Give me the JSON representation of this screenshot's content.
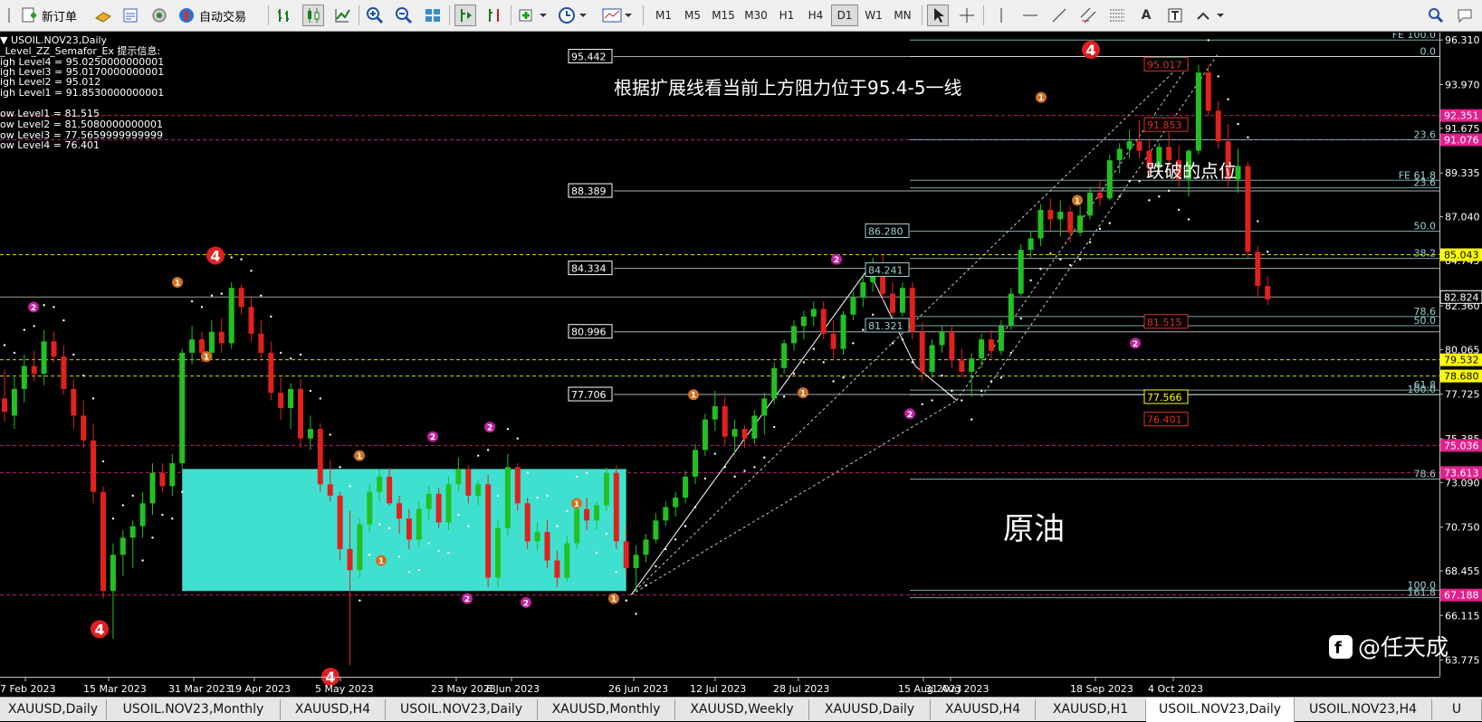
{
  "toolbar": {
    "new_order_label": "新订单",
    "autotrade_label": "自动交易",
    "timeframes": [
      "M1",
      "M5",
      "M15",
      "M30",
      "H1",
      "H4",
      "D1",
      "W1",
      "MN"
    ],
    "active_timeframe": "D1",
    "text_tool_label": "A"
  },
  "colors": {
    "background": "#000000",
    "bull": "#22c022",
    "bear": "#e0211e",
    "box": "#40e0d0",
    "fib": "#96d2d2",
    "res_line": "#e8e8e8"
  },
  "indicator_info": {
    "lines": [
      "▼ USOIL.NOV23,Daily",
      "_Level_ZZ_Semafor_Ex 提示信息:",
      "igh Level4 = 95.0250000000001",
      "igh Level3 = 95.0170000000001",
      "igh Level2 = 95.012",
      "igh Level1 = 91.8530000000001",
      "",
      "ow Level1 = 81.515",
      "ow Level2 = 81.5080000000001",
      "ow Level3 = 77.5659999999999",
      "ow Level4 = 76.401"
    ]
  },
  "annotations": {
    "resistance": "根据扩展线看当前上方阻力位于95.4-5一线",
    "breakdown": "跌破的点位",
    "instrument_cn": "原油"
  },
  "watermark": "@任天成",
  "chart_data": {
    "type": "candlestick",
    "symbol": "USOIL.NOV23",
    "timeframe": "Daily",
    "ylim": [
      62.9,
      96.7
    ],
    "price_axis": [
      "96.310",
      "93.970",
      "91.675",
      "89.335",
      "87.040",
      "84.745",
      "82.824",
      "82.360",
      "80.065",
      "77.725",
      "75.385",
      "73.090",
      "70.750",
      "68.455",
      "66.115",
      "63.775"
    ],
    "highlighted_prices": [
      {
        "value": "92.351",
        "color": "#e0208c"
      },
      {
        "value": "91.076",
        "color": "#e0208c"
      },
      {
        "value": "85.043",
        "color": "#ffff00"
      },
      {
        "value": "79.532",
        "color": "#ffff00"
      },
      {
        "value": "78.680",
        "color": "#ffff00"
      },
      {
        "value": "75.036",
        "color": "#e0208c"
      },
      {
        "value": "73.613",
        "color": "#e0208c"
      },
      {
        "value": "67.188",
        "color": "#e0208c"
      }
    ],
    "date_axis": [
      "7 Feb 2023",
      "15 Mar 2023",
      "31 Mar 2023",
      "19 Apr 2023",
      "5 May 2023",
      "23 May 2023",
      "8 Jun 2023",
      "26 Jun 2023",
      "12 Jul 2023",
      "28 Jul 2023",
      "15 Aug 2023",
      "31 Aug 2023",
      "18 Sep 2023",
      "4 Oct 2023"
    ],
    "left_labels": [
      {
        "text": "95.442",
        "y": 95.44
      },
      {
        "text": "88.389",
        "y": 88.39
      },
      {
        "text": "84.334",
        "y": 84.33
      },
      {
        "text": "80.996",
        "y": 81.0
      },
      {
        "text": "77.706",
        "y": 77.71
      }
    ],
    "mid_labels": [
      {
        "text": "86.280",
        "y": 86.28
      },
      {
        "text": "84.241",
        "y": 84.24
      },
      {
        "text": "81.321",
        "y": 81.32
      }
    ],
    "right_labels": [
      {
        "text": "95.017",
        "y": 95.02
      },
      {
        "text": "91.853",
        "y": 91.85
      },
      {
        "text": "81.515",
        "y": 81.52
      },
      {
        "text": "77.566",
        "y": 77.57
      },
      {
        "text": "76.401",
        "y": 76.4
      }
    ],
    "fib_levels": [
      {
        "text": "FE 100.0",
        "y": 96.31
      },
      {
        "text": "0.0",
        "y": 95.44
      },
      {
        "text": "23.6",
        "y": 91.08
      },
      {
        "text": "FE 61.8",
        "y": 88.95
      },
      {
        "text": "23.6",
        "y": 88.55
      },
      {
        "text": "50.0",
        "y": 86.28
      },
      {
        "text": "38.2",
        "y": 84.85
      },
      {
        "text": "78.6",
        "y": 81.8
      },
      {
        "text": "50.0",
        "y": 81.32
      },
      {
        "text": "61.8",
        "y": 77.94
      },
      {
        "text": "100.0",
        "y": 77.7
      },
      {
        "text": "78.6",
        "y": 73.27
      },
      {
        "text": "100.0",
        "y": 67.44
      },
      {
        "text": "161.8",
        "y": 67.05
      }
    ],
    "box": {
      "x0": 18,
      "x1": 63,
      "y0": 67.4,
      "y1": 73.8
    },
    "candles": [
      {
        "o": 77.5,
        "h": 79.0,
        "l": 76.3,
        "c": 76.8
      },
      {
        "o": 76.6,
        "h": 78.6,
        "l": 75.9,
        "c": 78.0
      },
      {
        "o": 78.0,
        "h": 79.8,
        "l": 77.3,
        "c": 79.2
      },
      {
        "o": 79.2,
        "h": 80.0,
        "l": 78.4,
        "c": 78.8
      },
      {
        "o": 78.8,
        "h": 81.1,
        "l": 78.2,
        "c": 80.5
      },
      {
        "o": 80.5,
        "h": 81.0,
        "l": 79.4,
        "c": 79.7
      },
      {
        "o": 79.7,
        "h": 80.3,
        "l": 77.7,
        "c": 78.0
      },
      {
        "o": 78.0,
        "h": 78.5,
        "l": 75.9,
        "c": 76.6
      },
      {
        "o": 76.6,
        "h": 77.4,
        "l": 74.9,
        "c": 75.3
      },
      {
        "o": 75.3,
        "h": 76.2,
        "l": 72.0,
        "c": 72.6
      },
      {
        "o": 72.6,
        "h": 72.9,
        "l": 67.0,
        "c": 67.4
      },
      {
        "o": 67.4,
        "h": 69.9,
        "l": 64.9,
        "c": 69.3
      },
      {
        "o": 69.3,
        "h": 70.6,
        "l": 68.2,
        "c": 70.2
      },
      {
        "o": 70.2,
        "h": 71.1,
        "l": 68.6,
        "c": 70.8
      },
      {
        "o": 70.8,
        "h": 72.6,
        "l": 70.2,
        "c": 72.0
      },
      {
        "o": 72.0,
        "h": 74.1,
        "l": 71.4,
        "c": 73.6
      },
      {
        "o": 73.6,
        "h": 74.1,
        "l": 72.6,
        "c": 72.9
      },
      {
        "o": 72.9,
        "h": 74.6,
        "l": 72.4,
        "c": 74.1
      },
      {
        "o": 74.1,
        "h": 80.1,
        "l": 73.8,
        "c": 79.9
      },
      {
        "o": 79.9,
        "h": 81.3,
        "l": 79.3,
        "c": 80.6
      },
      {
        "o": 80.6,
        "h": 81.0,
        "l": 79.4,
        "c": 79.9
      },
      {
        "o": 79.9,
        "h": 81.6,
        "l": 79.6,
        "c": 81.0
      },
      {
        "o": 81.0,
        "h": 81.7,
        "l": 79.9,
        "c": 80.4
      },
      {
        "o": 80.4,
        "h": 83.6,
        "l": 80.1,
        "c": 83.3
      },
      {
        "o": 83.3,
        "h": 83.5,
        "l": 81.9,
        "c": 82.3
      },
      {
        "o": 82.3,
        "h": 82.9,
        "l": 80.5,
        "c": 80.9
      },
      {
        "o": 80.9,
        "h": 81.6,
        "l": 79.6,
        "c": 79.9
      },
      {
        "o": 79.9,
        "h": 80.5,
        "l": 77.4,
        "c": 77.8
      },
      {
        "o": 77.8,
        "h": 78.6,
        "l": 76.4,
        "c": 77.0
      },
      {
        "o": 77.0,
        "h": 78.3,
        "l": 75.9,
        "c": 78.0
      },
      {
        "o": 78.0,
        "h": 78.5,
        "l": 74.9,
        "c": 75.4
      },
      {
        "o": 75.4,
        "h": 76.6,
        "l": 74.8,
        "c": 75.9
      },
      {
        "o": 75.9,
        "h": 76.2,
        "l": 72.6,
        "c": 73.0
      },
      {
        "o": 73.0,
        "h": 74.3,
        "l": 72.1,
        "c": 72.4
      },
      {
        "o": 72.4,
        "h": 72.6,
        "l": 69.0,
        "c": 69.6
      },
      {
        "o": 69.6,
        "h": 71.6,
        "l": 63.5,
        "c": 68.5
      },
      {
        "o": 68.5,
        "h": 71.2,
        "l": 68.1,
        "c": 70.9
      },
      {
        "o": 70.9,
        "h": 73.0,
        "l": 70.5,
        "c": 72.6
      },
      {
        "o": 72.6,
        "h": 73.8,
        "l": 72.1,
        "c": 73.4
      },
      {
        "o": 73.4,
        "h": 73.9,
        "l": 71.9,
        "c": 72.0
      },
      {
        "o": 72.0,
        "h": 72.4,
        "l": 70.4,
        "c": 71.2
      },
      {
        "o": 71.2,
        "h": 71.7,
        "l": 69.6,
        "c": 70.1
      },
      {
        "o": 70.1,
        "h": 72.1,
        "l": 69.7,
        "c": 71.7
      },
      {
        "o": 71.7,
        "h": 72.9,
        "l": 71.1,
        "c": 72.5
      },
      {
        "o": 72.5,
        "h": 72.8,
        "l": 70.7,
        "c": 71.0
      },
      {
        "o": 71.0,
        "h": 73.4,
        "l": 70.6,
        "c": 73.0
      },
      {
        "o": 73.0,
        "h": 74.4,
        "l": 72.6,
        "c": 73.8
      },
      {
        "o": 73.8,
        "h": 74.0,
        "l": 72.0,
        "c": 72.4
      },
      {
        "o": 72.4,
        "h": 73.2,
        "l": 71.9,
        "c": 73.0
      },
      {
        "o": 73.0,
        "h": 73.5,
        "l": 67.6,
        "c": 68.1
      },
      {
        "o": 68.1,
        "h": 71.1,
        "l": 67.6,
        "c": 70.7
      },
      {
        "o": 70.7,
        "h": 74.6,
        "l": 70.3,
        "c": 73.9
      },
      {
        "o": 73.9,
        "h": 74.1,
        "l": 71.6,
        "c": 72.0
      },
      {
        "o": 72.0,
        "h": 72.3,
        "l": 69.6,
        "c": 70.0
      },
      {
        "o": 70.0,
        "h": 71.0,
        "l": 69.5,
        "c": 70.5
      },
      {
        "o": 70.5,
        "h": 71.1,
        "l": 68.6,
        "c": 69.0
      },
      {
        "o": 69.0,
        "h": 69.5,
        "l": 67.6,
        "c": 68.1
      },
      {
        "o": 68.1,
        "h": 70.3,
        "l": 67.9,
        "c": 69.9
      },
      {
        "o": 69.9,
        "h": 72.1,
        "l": 69.6,
        "c": 71.7
      },
      {
        "o": 71.7,
        "h": 72.3,
        "l": 70.6,
        "c": 71.1
      },
      {
        "o": 71.1,
        "h": 72.1,
        "l": 70.6,
        "c": 71.9
      },
      {
        "o": 71.9,
        "h": 73.9,
        "l": 71.6,
        "c": 73.6
      },
      {
        "o": 73.6,
        "h": 74.0,
        "l": 69.6,
        "c": 70.0
      },
      {
        "o": 70.0,
        "h": 70.9,
        "l": 68.1,
        "c": 68.6
      },
      {
        "o": 68.6,
        "h": 69.8,
        "l": 67.4,
        "c": 69.3
      },
      {
        "o": 69.3,
        "h": 70.4,
        "l": 68.9,
        "c": 70.1
      },
      {
        "o": 70.1,
        "h": 71.5,
        "l": 69.9,
        "c": 71.1
      },
      {
        "o": 71.1,
        "h": 72.1,
        "l": 70.8,
        "c": 71.8
      },
      {
        "o": 71.8,
        "h": 72.6,
        "l": 71.3,
        "c": 72.3
      },
      {
        "o": 72.3,
        "h": 73.7,
        "l": 72.0,
        "c": 73.4
      },
      {
        "o": 73.4,
        "h": 75.1,
        "l": 73.0,
        "c": 74.8
      },
      {
        "o": 74.8,
        "h": 76.7,
        "l": 74.5,
        "c": 76.4
      },
      {
        "o": 76.4,
        "h": 77.9,
        "l": 75.8,
        "c": 77.1
      },
      {
        "o": 77.1,
        "h": 77.6,
        "l": 75.1,
        "c": 75.5
      },
      {
        "o": 75.5,
        "h": 76.4,
        "l": 74.6,
        "c": 75.9
      },
      {
        "o": 75.9,
        "h": 76.1,
        "l": 74.9,
        "c": 75.4
      },
      {
        "o": 75.4,
        "h": 76.9,
        "l": 75.1,
        "c": 76.6
      },
      {
        "o": 76.6,
        "h": 77.8,
        "l": 75.6,
        "c": 77.5
      },
      {
        "o": 77.5,
        "h": 79.4,
        "l": 77.2,
        "c": 79.1
      },
      {
        "o": 79.1,
        "h": 80.6,
        "l": 78.8,
        "c": 80.4
      },
      {
        "o": 80.4,
        "h": 81.6,
        "l": 80.0,
        "c": 81.3
      },
      {
        "o": 81.3,
        "h": 82.1,
        "l": 80.6,
        "c": 81.8
      },
      {
        "o": 81.8,
        "h": 82.6,
        "l": 81.3,
        "c": 82.2
      },
      {
        "o": 82.2,
        "h": 82.6,
        "l": 80.6,
        "c": 80.9
      },
      {
        "o": 80.9,
        "h": 81.6,
        "l": 79.6,
        "c": 80.1
      },
      {
        "o": 80.1,
        "h": 82.1,
        "l": 79.8,
        "c": 81.9
      },
      {
        "o": 81.9,
        "h": 83.1,
        "l": 81.6,
        "c": 82.8
      },
      {
        "o": 82.8,
        "h": 83.9,
        "l": 82.3,
        "c": 83.6
      },
      {
        "o": 83.6,
        "h": 84.9,
        "l": 83.1,
        "c": 84.5
      },
      {
        "o": 84.5,
        "h": 85.1,
        "l": 82.6,
        "c": 83.0
      },
      {
        "o": 83.0,
        "h": 83.6,
        "l": 81.6,
        "c": 82.0
      },
      {
        "o": 82.0,
        "h": 83.6,
        "l": 81.8,
        "c": 83.3
      },
      {
        "o": 83.3,
        "h": 83.6,
        "l": 80.6,
        "c": 81.0
      },
      {
        "o": 81.0,
        "h": 81.5,
        "l": 78.4,
        "c": 78.9
      },
      {
        "o": 78.9,
        "h": 80.6,
        "l": 78.6,
        "c": 80.3
      },
      {
        "o": 80.3,
        "h": 81.3,
        "l": 79.9,
        "c": 81.0
      },
      {
        "o": 81.0,
        "h": 81.3,
        "l": 79.1,
        "c": 79.5
      },
      {
        "o": 79.5,
        "h": 80.1,
        "l": 78.6,
        "c": 78.9
      },
      {
        "o": 78.9,
        "h": 79.9,
        "l": 77.6,
        "c": 79.6
      },
      {
        "o": 79.6,
        "h": 80.9,
        "l": 79.1,
        "c": 80.6
      },
      {
        "o": 80.6,
        "h": 81.1,
        "l": 79.6,
        "c": 80.0
      },
      {
        "o": 80.0,
        "h": 81.6,
        "l": 79.8,
        "c": 81.3
      },
      {
        "o": 81.3,
        "h": 83.3,
        "l": 81.1,
        "c": 83.0
      },
      {
        "o": 83.0,
        "h": 85.6,
        "l": 82.9,
        "c": 85.3
      },
      {
        "o": 85.3,
        "h": 86.3,
        "l": 84.9,
        "c": 85.9
      },
      {
        "o": 85.9,
        "h": 87.7,
        "l": 85.5,
        "c": 87.4
      },
      {
        "o": 87.4,
        "h": 88.0,
        "l": 86.3,
        "c": 86.9
      },
      {
        "o": 86.9,
        "h": 87.9,
        "l": 86.0,
        "c": 87.3
      },
      {
        "o": 87.3,
        "h": 87.6,
        "l": 85.7,
        "c": 86.2
      },
      {
        "o": 86.2,
        "h": 87.6,
        "l": 86.0,
        "c": 87.1
      },
      {
        "o": 87.1,
        "h": 88.6,
        "l": 86.9,
        "c": 88.3
      },
      {
        "o": 88.3,
        "h": 88.9,
        "l": 87.6,
        "c": 88.0
      },
      {
        "o": 88.0,
        "h": 90.3,
        "l": 87.9,
        "c": 90.0
      },
      {
        "o": 90.0,
        "h": 90.9,
        "l": 89.3,
        "c": 90.6
      },
      {
        "o": 90.6,
        "h": 91.6,
        "l": 90.1,
        "c": 91.0
      },
      {
        "o": 91.0,
        "h": 92.1,
        "l": 90.1,
        "c": 90.5
      },
      {
        "o": 90.5,
        "h": 91.1,
        "l": 89.1,
        "c": 89.6
      },
      {
        "o": 89.6,
        "h": 90.9,
        "l": 89.3,
        "c": 90.7
      },
      {
        "o": 90.7,
        "h": 91.6,
        "l": 89.6,
        "c": 90.0
      },
      {
        "o": 90.0,
        "h": 90.8,
        "l": 88.6,
        "c": 89.0
      },
      {
        "o": 89.0,
        "h": 90.6,
        "l": 88.1,
        "c": 90.5
      },
      {
        "o": 90.5,
        "h": 95.0,
        "l": 90.3,
        "c": 94.6
      },
      {
        "o": 94.6,
        "h": 95.0,
        "l": 92.3,
        "c": 92.6
      },
      {
        "o": 92.6,
        "h": 93.1,
        "l": 90.6,
        "c": 91.0
      },
      {
        "o": 91.0,
        "h": 91.9,
        "l": 88.6,
        "c": 89.0
      },
      {
        "o": 89.0,
        "h": 90.6,
        "l": 88.3,
        "c": 89.7
      },
      {
        "o": 89.7,
        "h": 89.9,
        "l": 84.9,
        "c": 85.2
      },
      {
        "o": 85.2,
        "h": 85.5,
        "l": 82.9,
        "c": 83.4
      },
      {
        "o": 83.4,
        "h": 83.9,
        "l": 82.4,
        "c": 82.7
      }
    ]
  },
  "tabs": [
    {
      "label": "XAUUSD,Daily",
      "active": false
    },
    {
      "label": "USOIL.NOV23,Monthly",
      "active": false
    },
    {
      "label": "XAUUSD,H4",
      "active": false
    },
    {
      "label": "USOIL.NOV23,Daily",
      "active": false
    },
    {
      "label": "XAUUSD,Monthly",
      "active": false
    },
    {
      "label": "XAUUSD,Weekly",
      "active": false
    },
    {
      "label": "XAUUSD,Daily",
      "active": false
    },
    {
      "label": "XAUUSD,H4",
      "active": false
    },
    {
      "label": "XAUUSD,H1",
      "active": false
    },
    {
      "label": "USOIL.NOV23,Daily",
      "active": true
    },
    {
      "label": "USOIL.NOV23,H4",
      "active": false
    },
    {
      "label": "U",
      "active": false
    }
  ]
}
